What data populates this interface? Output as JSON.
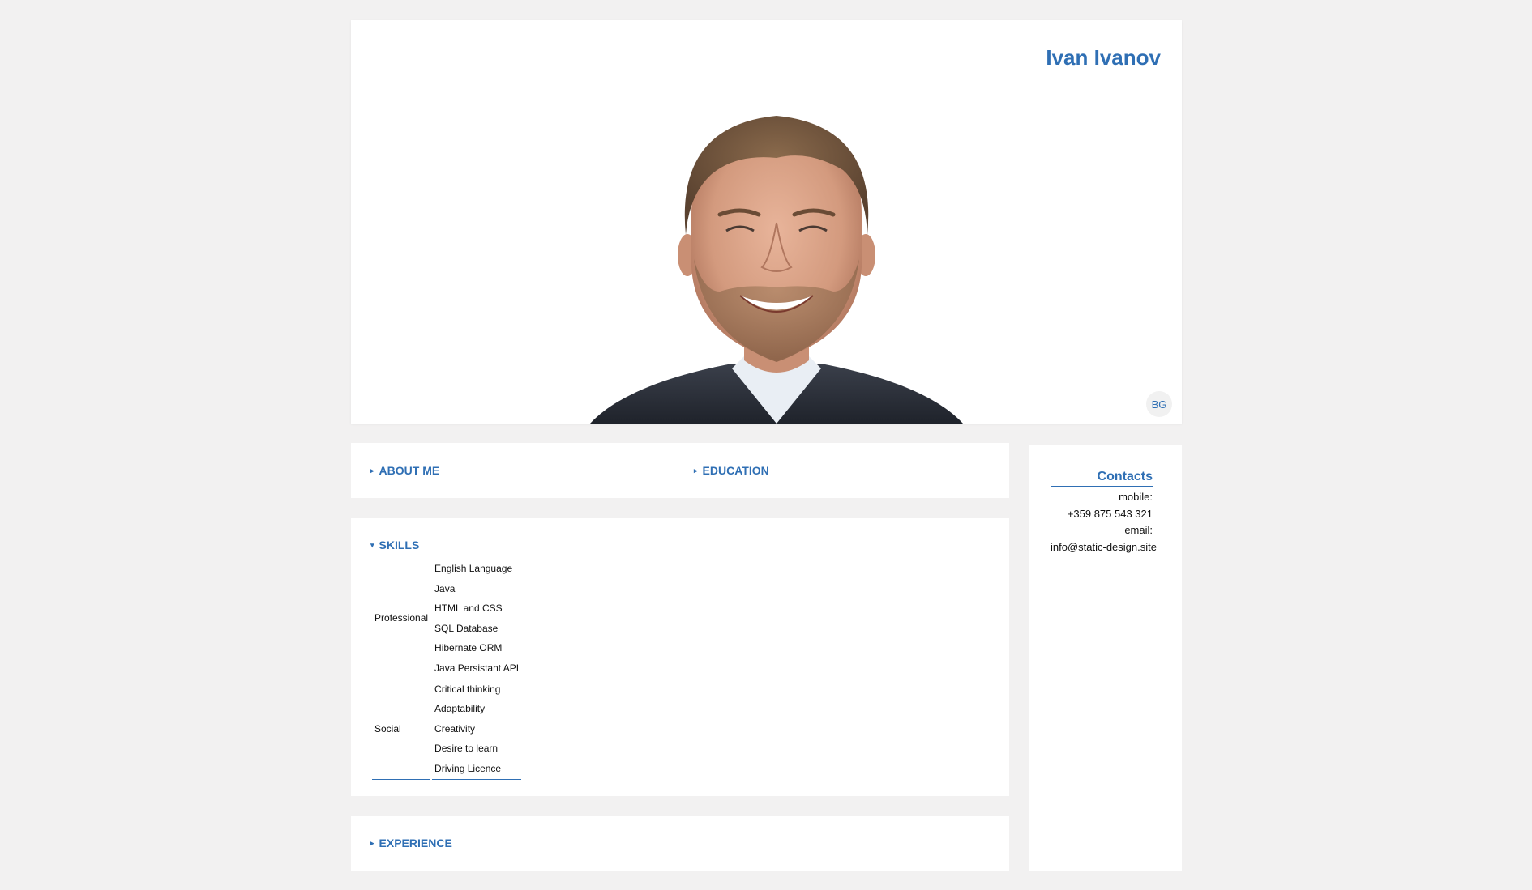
{
  "profile": {
    "name": "Ivan Ivanov",
    "language_button": "BG"
  },
  "sections": {
    "about": {
      "label": "ABOUT ME",
      "arrow": "▸"
    },
    "education": {
      "label": "EDUCATION",
      "arrow": "▸"
    },
    "skills": {
      "label": "SKILLS",
      "arrow": "▾"
    },
    "experience": {
      "label": "EXPERIENCE",
      "arrow": "▸"
    }
  },
  "skills": {
    "groups": [
      {
        "category": "Professional",
        "items": [
          "English Language",
          "Java",
          "HTML and CSS",
          "SQL Database",
          "Hibernate ORM",
          "Java Persistant API"
        ]
      },
      {
        "category": "Social",
        "items": [
          "Critical thinking",
          "Adaptability",
          "Creativity",
          "Desire to learn",
          "Driving Licence"
        ]
      }
    ]
  },
  "contacts": {
    "title": "Contacts",
    "mobile_label": "mobile:",
    "mobile_value": "+359 875 543 321",
    "email_label": "email:",
    "email_value": "info@static-design.site"
  },
  "colors": {
    "accent": "#2f6fb4",
    "background": "#f2f1f1",
    "panel": "#ffffff"
  }
}
